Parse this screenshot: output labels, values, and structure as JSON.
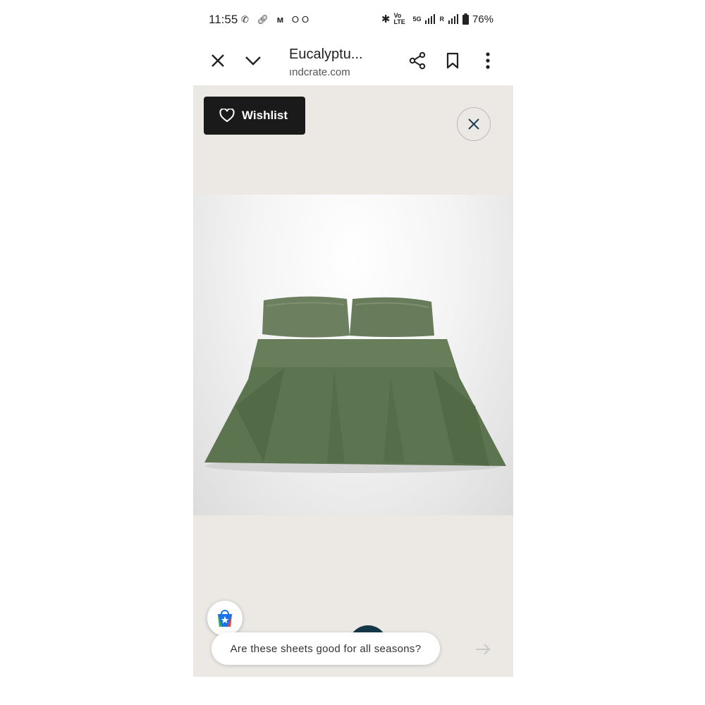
{
  "status_bar": {
    "time": "11:55",
    "left_icons": [
      "whatsapp-icon",
      "link-icon",
      "mi-icon",
      "voicemail-icon"
    ],
    "volte": "Vo LTE",
    "network": "5G",
    "roaming": "R",
    "battery": "76%"
  },
  "browser": {
    "title": "Eucalyptu...",
    "url": "ındcrate.com"
  },
  "page": {
    "wishlist_label": "Wishlist",
    "suggestion_text": "Are these sheets good for all seasons?"
  },
  "colors": {
    "background": "#ece9e5",
    "wishlist_bg": "#1a1a1a",
    "sheet_green": "#5d7450",
    "dark_button": "#14384a"
  }
}
